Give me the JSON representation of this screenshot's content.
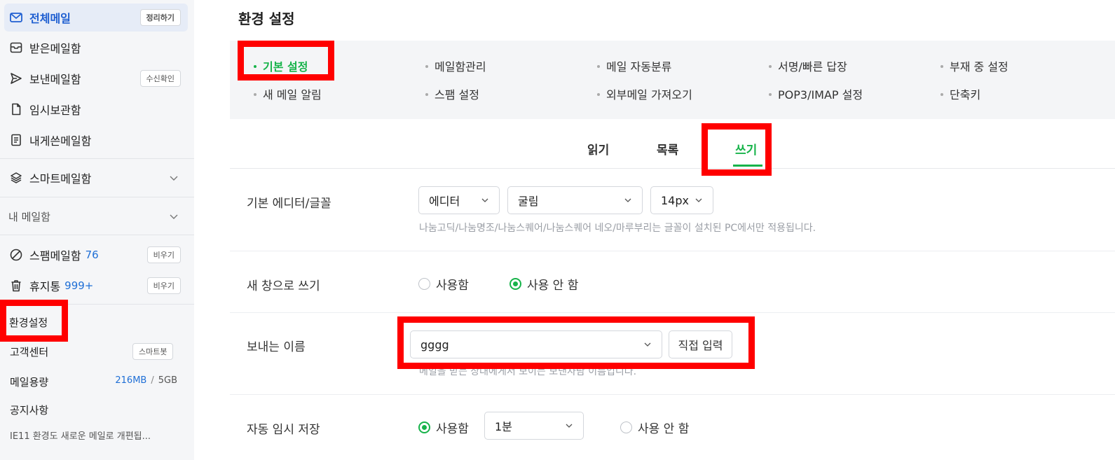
{
  "sidebar": {
    "all_mail": {
      "label": "전체메일",
      "pill": "정리하기"
    },
    "inbox": {
      "label": "받은메일함"
    },
    "sent": {
      "label": "보낸메일함",
      "pill": "수신확인"
    },
    "drafts": {
      "label": "임시보관함"
    },
    "to_me": {
      "label": "내게쓴메일함"
    },
    "smart": {
      "label": "스마트메일함"
    },
    "my_mailboxes": {
      "label": "내 메일함"
    },
    "spam": {
      "label": "스팸메일함",
      "count": "76",
      "pill": "비우기"
    },
    "trash": {
      "label": "휴지통",
      "count": "999+",
      "pill": "비우기"
    },
    "settings": {
      "label": "환경설정"
    },
    "support": {
      "label": "고객센터",
      "pill": "스마트봇"
    },
    "storage": {
      "label": "메일용량",
      "used": "216MB",
      "sep": "/",
      "total": "5GB"
    },
    "notice": {
      "label": "공지사항",
      "text": "IE11 환경도 새로운 메일로 개편됩..."
    }
  },
  "main": {
    "title": "환경 설정",
    "menu_row1": [
      "기본 설정",
      "메일함관리",
      "메일 자동분류",
      "서명/빠른 답장",
      "부재 중 설정"
    ],
    "menu_row2": [
      "새 메일 알림",
      "스팸 설정",
      "외부메일 가져오기",
      "POP3/IMAP 설정",
      "단축키"
    ],
    "tabs": [
      "읽기",
      "목록",
      "쓰기"
    ],
    "active_tab": "쓰기",
    "editor": {
      "label": "기본 에디터/글꼴",
      "editor_value": "에디터",
      "font_value": "굴림",
      "size_value": "14px",
      "hint": "나눔고딕/나눔명조/나눔스퀘어/나눔스퀘어 네오/마루부리는 글꼴이 설치된 PC에서만 적용됩니다."
    },
    "new_window": {
      "label": "새 창으로 쓰기",
      "option_on": "사용함",
      "option_off": "사용 안 함",
      "selected": "사용 안 함"
    },
    "sender_name": {
      "label": "보내는 이름",
      "value": "gggg",
      "direct_button": "직접 입력",
      "hint": "메일을 받는 상대에게서 보이는 보낸사람 이름입니다."
    },
    "autosave": {
      "label": "자동 임시 저장",
      "option_on": "사용함",
      "interval": "1분",
      "option_off": "사용 안 함",
      "selected": "사용함"
    }
  },
  "colors": {
    "accent_green": "#17b34a",
    "link_blue": "#1f6fd6",
    "annotation_red": "#ff0000",
    "sidebar_bg": "#f5f6f8"
  }
}
